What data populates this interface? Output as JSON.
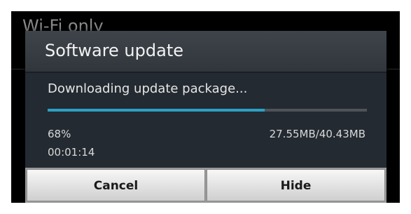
{
  "background": {
    "title": "Wi-Fi only"
  },
  "dialog": {
    "title": "Software update",
    "message": "Downloading update package...",
    "progress_percent": 68,
    "percent_label": "68%",
    "size_label": "27.55MB/40.43MB",
    "elapsed_label": "00:01:14",
    "buttons": {
      "cancel_label": "Cancel",
      "hide_label": "Hide"
    }
  },
  "colors": {
    "progress_fill": "#2d9fc4",
    "progress_track": "#4d5358",
    "dialog_bg": "#232a31"
  }
}
